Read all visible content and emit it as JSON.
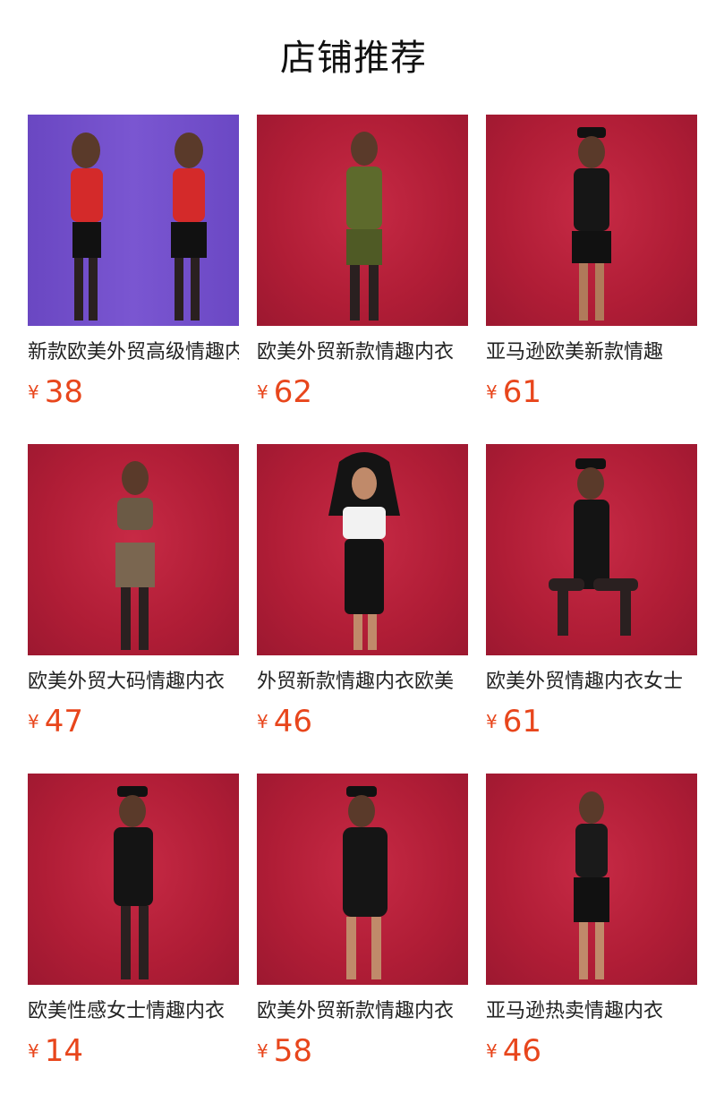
{
  "header": {
    "title": "店铺推荐"
  },
  "colors": {
    "price": "#e8461c",
    "thumb_red": "#b81f38",
    "thumb_purple": "#6a47c2"
  },
  "products": [
    {
      "name": "新款欧美外贸高级情趣内衣",
      "currency": "¥",
      "price": "38",
      "bg": "purple"
    },
    {
      "name": "欧美外贸新款情趣内衣",
      "currency": "¥",
      "price": "62",
      "bg": "red"
    },
    {
      "name": "亚马逊欧美新款情趣",
      "currency": "¥",
      "price": "61",
      "bg": "red"
    },
    {
      "name": "欧美外贸大码情趣内衣",
      "currency": "¥",
      "price": "47",
      "bg": "red"
    },
    {
      "name": "外贸新款情趣内衣欧美",
      "currency": "¥",
      "price": "46",
      "bg": "red"
    },
    {
      "name": "欧美外贸情趣内衣女士",
      "currency": "¥",
      "price": "61",
      "bg": "red"
    },
    {
      "name": "欧美性感女士情趣内衣",
      "currency": "¥",
      "price": "14",
      "bg": "red"
    },
    {
      "name": "欧美外贸新款情趣内衣",
      "currency": "¥",
      "price": "58",
      "bg": "red"
    },
    {
      "name": "亚马逊热卖情趣内衣",
      "currency": "¥",
      "price": "46",
      "bg": "red"
    }
  ]
}
